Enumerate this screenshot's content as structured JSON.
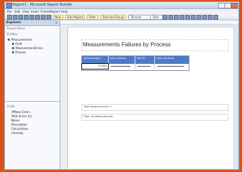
{
  "window": {
    "title": "Report1 - Microsoft Report Builder"
  },
  "menu": {
    "items": [
      "File",
      "Edit",
      "View",
      "Insert",
      "Format",
      "Report",
      "Help"
    ]
  },
  "toolbar": {
    "buttons": [
      "New",
      "Run Report",
      "Filter",
      "Sort and Group"
    ],
    "font_name": "Tahoma",
    "font_size": "10pt"
  },
  "explorer": {
    "title": "Explorer",
    "report_items_label": "Report Items",
    "section_label": "Entities",
    "tree": [
      "Measurements",
      "Field",
      "MeasurementErrors",
      "Process"
    ],
    "fields_label": "Fields",
    "fields": [
      "#Meas Errors",
      "Total Errors (h)",
      "Name",
      "Description",
      "Calculations",
      "Anomaly"
    ]
  },
  "report": {
    "title": "Measurements Failures by Process",
    "columns": [
      "Value Number",
      "Value Rating",
      "Test ID",
      "Value ID Array"
    ],
    "first_cell_value": "0.0000",
    "total_label": "Total Measurements: 0",
    "filter_label": "Filter: all Measurements"
  },
  "colors": {
    "background": "#d8521a",
    "table_header": "#4e7ac7",
    "page": "#ffffff"
  }
}
